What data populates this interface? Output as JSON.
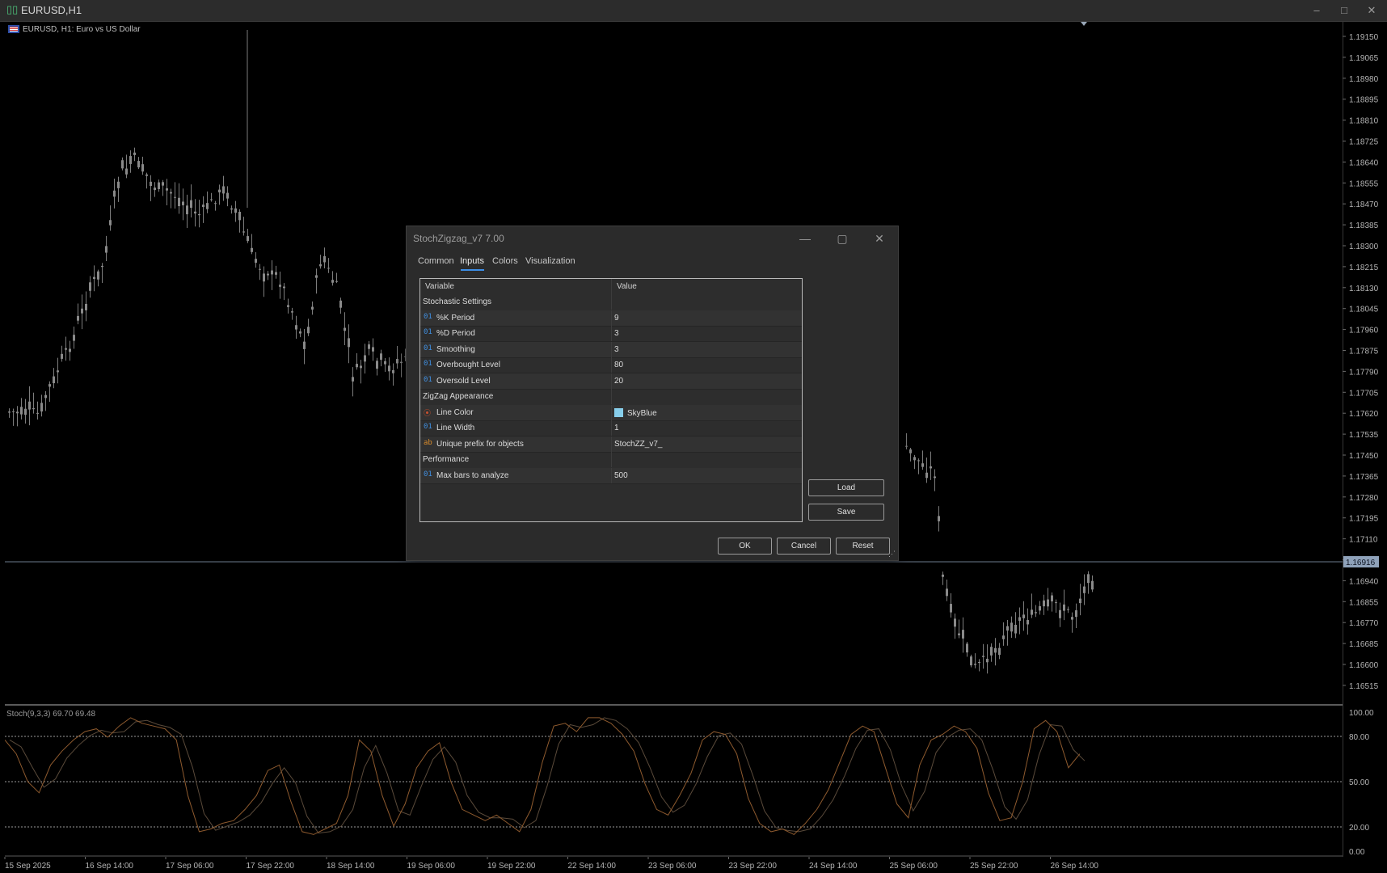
{
  "window": {
    "title": "EURUSD,H1",
    "icon": "chart-icon"
  },
  "chart": {
    "symbol_label": "EURUSD, H1:  Euro vs US Dollar",
    "current_price": "1.16916",
    "price_ticks": [
      "1.19150",
      "1.19065",
      "1.18980",
      "1.18895",
      "1.18810",
      "1.18725",
      "1.18640",
      "1.18555",
      "1.18470",
      "1.18385",
      "1.18300",
      "1.18215",
      "1.18130",
      "1.18045",
      "1.17960",
      "1.17875",
      "1.17790",
      "1.17705",
      "1.17620",
      "1.17535",
      "1.17450",
      "1.17365",
      "1.17280",
      "1.17195",
      "1.17110",
      "1.17025",
      "1.16940",
      "1.16855",
      "1.16770",
      "1.16685",
      "1.16600",
      "1.16515"
    ],
    "time_ticks": [
      "15 Sep 2025",
      "16 Sep 14:00",
      "17 Sep 06:00",
      "17 Sep 22:00",
      "18 Sep 14:00",
      "19 Sep 06:00",
      "19 Sep 22:00",
      "22 Sep 14:00",
      "23 Sep 06:00",
      "23 Sep 22:00",
      "24 Sep 14:00",
      "25 Sep 06:00",
      "25 Sep 22:00",
      "26 Sep 14:00"
    ],
    "colors": {
      "candle": "#8a8a8a",
      "price_line": "#6c7a8c",
      "stoch_main": "#8e5a2e",
      "stoch_signal": "#5a4a3a"
    }
  },
  "oscillator": {
    "label": "Stoch(9,3,3) 69.70 69.48",
    "ticks": [
      "100.00",
      "80.00",
      "50.00",
      "20.00",
      "0.00"
    ]
  },
  "chart_data": {
    "type": "line",
    "series": [
      {
        "name": "Stoch(9,3,3)",
        "values": [
          80,
          70,
          50,
          42,
          62,
          72,
          80,
          86,
          88,
          82,
          90,
          96,
          92,
          90,
          88,
          80,
          40,
          14,
          16,
          20,
          22,
          30,
          40,
          58,
          62,
          36,
          14,
          12,
          16,
          20,
          40,
          80,
          72,
          40,
          18,
          34,
          60,
          72,
          78,
          50,
          30,
          26,
          22,
          26,
          20,
          14,
          30,
          64,
          90,
          92,
          86,
          96,
          96,
          92,
          84,
          72,
          48,
          30,
          26,
          40,
          56,
          80,
          86,
          84,
          70,
          38,
          20,
          14,
          16,
          12,
          20,
          30,
          44,
          64,
          84,
          90,
          86,
          60,
          34,
          24,
          62,
          80,
          84,
          90,
          86,
          74,
          42,
          22,
          24,
          50,
          88,
          94,
          86,
          60,
          70
        ]
      }
    ]
  },
  "dialog": {
    "title": "StochZigzag_v7 7.00",
    "tabs": [
      "Common",
      "Inputs",
      "Colors",
      "Visualization"
    ],
    "active_tab": "Inputs",
    "columns": {
      "variable": "Variable",
      "value": "Value"
    },
    "rows": [
      {
        "kind": "group",
        "name": "Stochastic Settings"
      },
      {
        "kind": "param",
        "icon": "01",
        "name": "%K Period",
        "value": "9"
      },
      {
        "kind": "param",
        "icon": "01",
        "name": "%D Period",
        "value": "3"
      },
      {
        "kind": "param",
        "icon": "01",
        "name": "Smoothing",
        "value": "3"
      },
      {
        "kind": "param",
        "icon": "01",
        "name": "Overbought Level",
        "value": "80"
      },
      {
        "kind": "param",
        "icon": "01",
        "name": "Oversold Level",
        "value": "20"
      },
      {
        "kind": "group",
        "name": "ZigZag Appearance"
      },
      {
        "kind": "color",
        "icon": "palette",
        "name": "Line Color",
        "value": "SkyBlue",
        "swatch": "#87ceeb"
      },
      {
        "kind": "param",
        "icon": "01",
        "name": "Line Width",
        "value": "1"
      },
      {
        "kind": "param",
        "icon": "ab",
        "name": "Unique prefix for objects",
        "value": "StochZZ_v7_"
      },
      {
        "kind": "group",
        "name": "Performance"
      },
      {
        "kind": "param",
        "icon": "01",
        "name": "Max bars to analyze",
        "value": "500"
      }
    ],
    "buttons": {
      "load": "Load",
      "save": "Save",
      "ok": "OK",
      "cancel": "Cancel",
      "reset": "Reset"
    }
  }
}
